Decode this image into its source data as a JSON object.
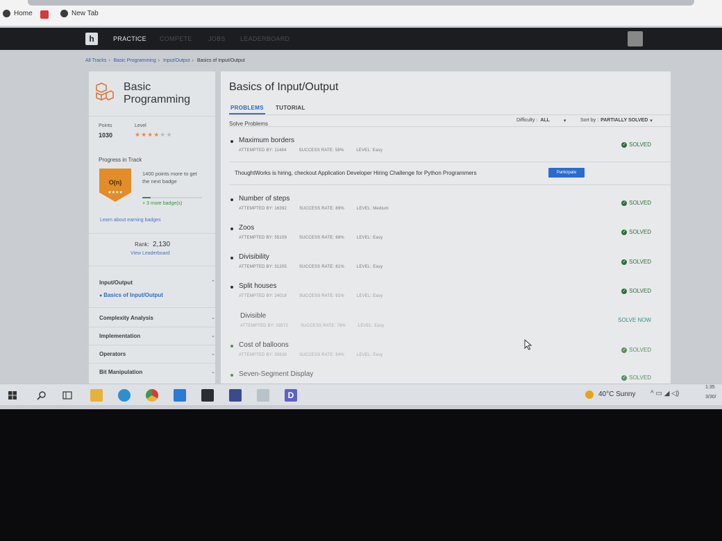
{
  "browser": {
    "bookmarks": [
      {
        "label": "Home"
      },
      {
        "label": "New Tab"
      }
    ]
  },
  "header": {
    "nav": [
      {
        "label": "PRACTICE",
        "active": true
      },
      {
        "label": "COMPETE",
        "active": false
      },
      {
        "label": "JOBS",
        "active": false
      },
      {
        "label": "LEADERBOARD",
        "active": false
      }
    ]
  },
  "breadcrumb": [
    "All Tracks",
    "Basic Programming",
    "Input/Output",
    "Basics of Input/Output"
  ],
  "sidebar": {
    "track_title": "Basic Programming",
    "points_label": "Points",
    "points_value": "1030",
    "level_label": "Level",
    "level_stars": 4,
    "level_stars_total": 6,
    "progress_label": "Progress in Track",
    "badge_label": "O(n)",
    "badge_stars": "★★★★",
    "points_needed": "1400 points more to get the next badge",
    "progress_fraction": 0.14,
    "more_badges": "+ 3 more badge(s)",
    "learn_link": "Learn about earning badges",
    "rank_label": "Rank:",
    "rank_value": "2,130",
    "leaderboard_link": "View Leaderboard",
    "menu": [
      {
        "label": "Input/Output",
        "expanded": true
      },
      {
        "label": "Basics of Input/Output",
        "sub": true
      },
      {
        "label": "Complexity Analysis"
      },
      {
        "label": "Implementation"
      },
      {
        "label": "Operators"
      },
      {
        "label": "Bit Manipulation"
      }
    ]
  },
  "main": {
    "title": "Basics of Input/Output",
    "tabs": [
      {
        "label": "PROBLEMS",
        "active": true
      },
      {
        "label": "TUTORIAL",
        "active": false
      }
    ],
    "solve_label": "Solve Problems",
    "difficulty_label": "Difficulty :",
    "difficulty_value": "ALL",
    "sort_label": "Sort by :",
    "sort_value": "PARTIALLY SOLVED",
    "hiring_text": "ThoughtWorks is hiring, checkout Application Developer Hiring Challenge for Python Programmers",
    "participate_label": "Participate",
    "problems": [
      {
        "name": "Maximum borders",
        "attempted": "ATTEMPTED BY: 11484",
        "success": "SUCCESS RATE: 58%",
        "level": "LEVEL: Easy",
        "status": "SOLVED"
      },
      {
        "name": "Number of steps",
        "attempted": "ATTEMPTED BY: 16392",
        "success": "SUCCESS RATE: 89%",
        "level": "LEVEL: Medium",
        "status": "SOLVED"
      },
      {
        "name": "Zoos",
        "attempted": "ATTEMPTED BY: 55109",
        "success": "SUCCESS RATE: 88%",
        "level": "LEVEL: Easy",
        "status": "SOLVED"
      },
      {
        "name": "Divisibility",
        "attempted": "ATTEMPTED BY: 31205",
        "success": "SUCCESS RATE: 81%",
        "level": "LEVEL: Easy",
        "status": "SOLVED"
      },
      {
        "name": "Split houses",
        "attempted": "ATTEMPTED BY: 24018",
        "success": "SUCCESS RATE: 91%",
        "level": "LEVEL: Easy",
        "status": "SOLVED"
      },
      {
        "name": "Divisible",
        "attempted": "ATTEMPTED BY: 29572",
        "success": "SUCCESS RATE: 78%",
        "level": "LEVEL: Easy",
        "status": "SOLVE NOW"
      },
      {
        "name": "Cost of balloons",
        "attempted": "ATTEMPTED BY: 35638",
        "success": "SUCCESS RATE: 84%",
        "level": "LEVEL: Easy",
        "status": "SOLVED"
      },
      {
        "name": "Seven-Segment Display",
        "attempted": "",
        "success": "",
        "level": "",
        "status": "SOLVED"
      }
    ]
  },
  "taskbar": {
    "weather": "40°C  Sunny",
    "time": "1:35",
    "date": "3/30/"
  },
  "colors": {
    "accent": "#3a6fc4",
    "solved": "#2f6e3a",
    "header_bg": "#1b1d20",
    "badge": "#e28c2a"
  }
}
